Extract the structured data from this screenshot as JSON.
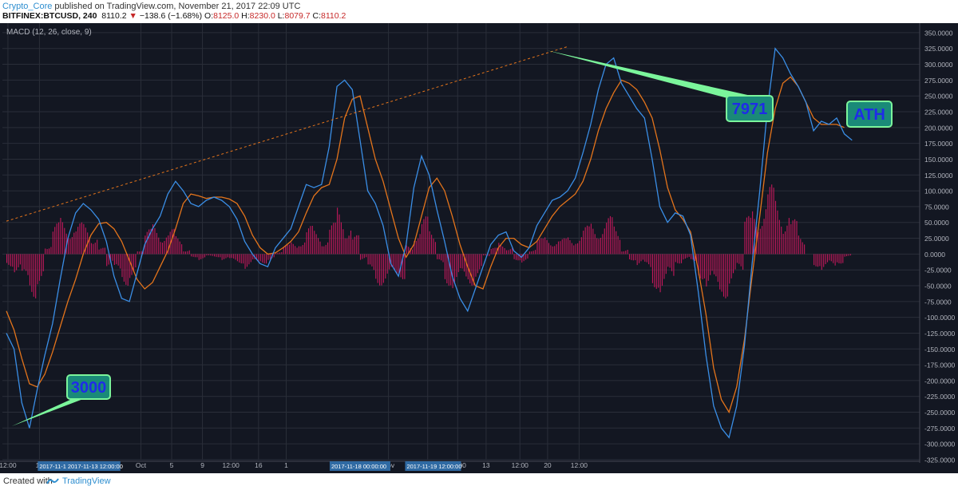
{
  "header": {
    "author": "Crypto_Core",
    "published": " published on TradingView.com, November 21, 2017 22:09 UTC",
    "symbol": "BITFINEX:BTCUSD, 240",
    "last": "8110.2",
    "change": "−138.6 (−1.68%)",
    "o_label": "O:",
    "o": "8125.0",
    "h_label": "H:",
    "h": "8230.0",
    "l_label": "L:",
    "l": "8079.7",
    "c_label": "C:",
    "c": "8110.2"
  },
  "footer": {
    "created_with": "Created with",
    "brand": "TradingView"
  },
  "chart_data": {
    "type": "line",
    "title": "MACD (12, 26, close, 9)",
    "ylim": [
      -325,
      360
    ],
    "y_ticks": [
      "350.0000",
      "325.0000",
      "300.0000",
      "275.0000",
      "250.0000",
      "225.0000",
      "200.0000",
      "175.0000",
      "150.0000",
      "125.0000",
      "100.0000",
      "75.0000",
      "50.0000",
      "25.0000",
      "0.0000",
      "-25.0000",
      "-50.0000",
      "-75.0000",
      "-100.0000",
      "-125.0000",
      "-150.0000",
      "-175.0000",
      "-200.0000",
      "-225.0000",
      "-250.0000",
      "-275.0000",
      "-300.0000",
      "-325.0000"
    ],
    "x_ticks": [
      {
        "label": "12:00",
        "i": 0.2
      },
      {
        "label": "18",
        "i": 4.3
      },
      {
        "label": "Oct",
        "i": 17.5
      },
      {
        "label": "5",
        "i": 21.5
      },
      {
        "label": "9",
        "i": 25.5
      },
      {
        "label": "12:00",
        "i": 29.2
      },
      {
        "label": "16",
        "i": 32.8
      },
      {
        "label": "1",
        "i": 36.4
      },
      {
        "label": "Nov",
        "i": 49.7
      },
      {
        "label": "6",
        "i": 54.8
      },
      {
        "label": "12:00",
        "i": 58.7
      },
      {
        "label": "13",
        "i": 62.4
      },
      {
        "label": "12:00",
        "i": 66.8
      },
      {
        "label": "20",
        "i": 70.4
      },
      {
        "label": "12:00",
        "i": 74.5
      }
    ],
    "x_highlights": [
      "2017-11-12 20:00:0",
      "2017-11-13 12:00:00",
      "2017-11-18 00:00:00",
      "2017-11-19 12:00:00"
    ],
    "series": [
      {
        "name": "MACD",
        "color": "#3a8ee6",
        "values": [
          -125,
          -150,
          -235,
          -275,
          -215,
          -160,
          -110,
          -40,
          25,
          65,
          80,
          70,
          55,
          20,
          -35,
          -70,
          -75,
          -30,
          15,
          40,
          60,
          95,
          115,
          100,
          80,
          75,
          85,
          90,
          85,
          75,
          55,
          20,
          0,
          -15,
          -20,
          10,
          25,
          40,
          75,
          110,
          105,
          110,
          170,
          265,
          275,
          260,
          180,
          100,
          80,
          45,
          -15,
          -35,
          15,
          105,
          155,
          125,
          70,
          20,
          -35,
          -70,
          -90,
          -55,
          -20,
          15,
          30,
          35,
          5,
          -5,
          10,
          45,
          65,
          85,
          90,
          100,
          120,
          160,
          205,
          260,
          300,
          310,
          270,
          250,
          230,
          215,
          150,
          75,
          50,
          65,
          60,
          30,
          -60,
          -160,
          -240,
          -275,
          -290,
          -240,
          -145,
          -15,
          100,
          230,
          325,
          310,
          285,
          265,
          240,
          195,
          210,
          205,
          215,
          190,
          180
        ]
      },
      {
        "name": "Signal",
        "color": "#e4741b",
        "values": [
          -90,
          -120,
          -165,
          -205,
          -210,
          -190,
          -155,
          -115,
          -75,
          -40,
          0,
          30,
          48,
          50,
          40,
          20,
          -10,
          -40,
          -55,
          -45,
          -20,
          5,
          40,
          80,
          95,
          92,
          88,
          90,
          90,
          87,
          80,
          60,
          30,
          10,
          0,
          2,
          10,
          20,
          35,
          65,
          92,
          105,
          110,
          150,
          215,
          245,
          250,
          200,
          150,
          115,
          70,
          25,
          -5,
          15,
          60,
          105,
          120,
          100,
          60,
          15,
          -20,
          -50,
          -55,
          -20,
          10,
          25,
          25,
          15,
          10,
          20,
          40,
          60,
          75,
          85,
          95,
          115,
          150,
          195,
          230,
          255,
          275,
          270,
          260,
          240,
          215,
          165,
          105,
          70,
          55,
          35,
          -25,
          -95,
          -180,
          -230,
          -250,
          -210,
          -135,
          -35,
          60,
          160,
          230,
          270,
          280,
          265,
          240,
          215,
          205,
          205,
          205,
          200
        ]
      },
      {
        "name": "Histogram",
        "color": "#c2185b",
        "values": [
          -20,
          -30,
          -60,
          -70,
          -50,
          20,
          50,
          60,
          60,
          50,
          50,
          40,
          10,
          -20,
          -40,
          -50,
          -40,
          10,
          40,
          50,
          45,
          40,
          30,
          10,
          -5,
          -10,
          -5,
          -5,
          -10,
          -15,
          -15,
          -25,
          -20,
          -15,
          -10,
          5,
          15,
          20,
          30,
          45,
          40,
          30,
          50,
          80,
          60,
          30,
          -10,
          -40,
          -50,
          -50,
          -50,
          -40,
          15,
          50,
          60,
          40,
          -20,
          -50,
          -60,
          -55,
          -50,
          -40,
          -5,
          10,
          20,
          15,
          -10,
          -15,
          10,
          25,
          30,
          30,
          25,
          30,
          40,
          45,
          55,
          60,
          60,
          50,
          10,
          -10,
          -20,
          -30,
          -55,
          -70,
          -50,
          -15,
          -10,
          -20,
          -40,
          -60,
          -80,
          -70,
          -55,
          -35,
          60,
          80,
          100,
          110,
          100,
          80,
          55,
          35,
          0,
          -20,
          -30,
          -25,
          -15,
          -5
        ]
      }
    ],
    "trendline": {
      "from": {
        "i": 0,
        "v": 52
      },
      "to": {
        "i": 73,
        "v": 328
      },
      "color": "#e4741b",
      "style": "dashed"
    },
    "annotations": [
      {
        "text": "3000",
        "at": {
          "i": 0.7,
          "v": -272
        },
        "tip_side": "left"
      },
      {
        "text": "7971",
        "at": {
          "i": 70.3,
          "v": 322
        },
        "tip_side": "right"
      },
      {
        "text": "ATH",
        "at": {
          "i": 75.5,
          "v": 200
        },
        "tip_side": "down"
      }
    ],
    "grid": true,
    "colors": {
      "background": "#131722",
      "grid": "#2a2e39",
      "axis_text": "#b2b5be",
      "label_fill": "#1a8a78",
      "label_border": "#7bf59b",
      "label_text": "#1f2be8",
      "highlight": "#2f6aa3"
    }
  }
}
